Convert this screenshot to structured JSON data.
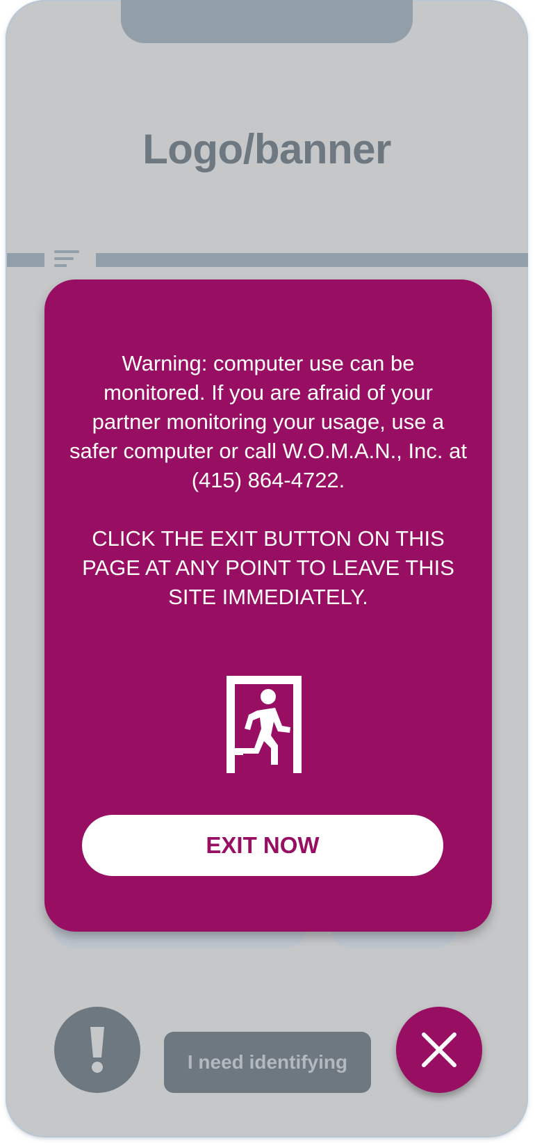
{
  "header": {
    "logo_text": "Logo/banner"
  },
  "icons": {
    "menu": "menu-lines-icon",
    "exit": "emergency-exit-icon",
    "alert": "exclamation-icon",
    "close": "close-icon"
  },
  "modal": {
    "warning_text": "Warning: computer use can be monitored. If you are afraid of your partner monitoring your usage, use a safer computer or call W.O.M.A.N., Inc. at (415) 864-4722.",
    "instruction_text": "CLICK THE EXIT BUTTON ON THIS PAGE AT ANY POINT TO LEAVE THIS SITE IMMEDIATELY.",
    "exit_button_label": "EXIT NOW"
  },
  "bottom_bar": {
    "identify_label": "I need identifying"
  },
  "colors": {
    "brand": "#980e63",
    "phone_bg": "#c6c7c9",
    "muted": "#6d7880",
    "bar": "#939fa8"
  }
}
